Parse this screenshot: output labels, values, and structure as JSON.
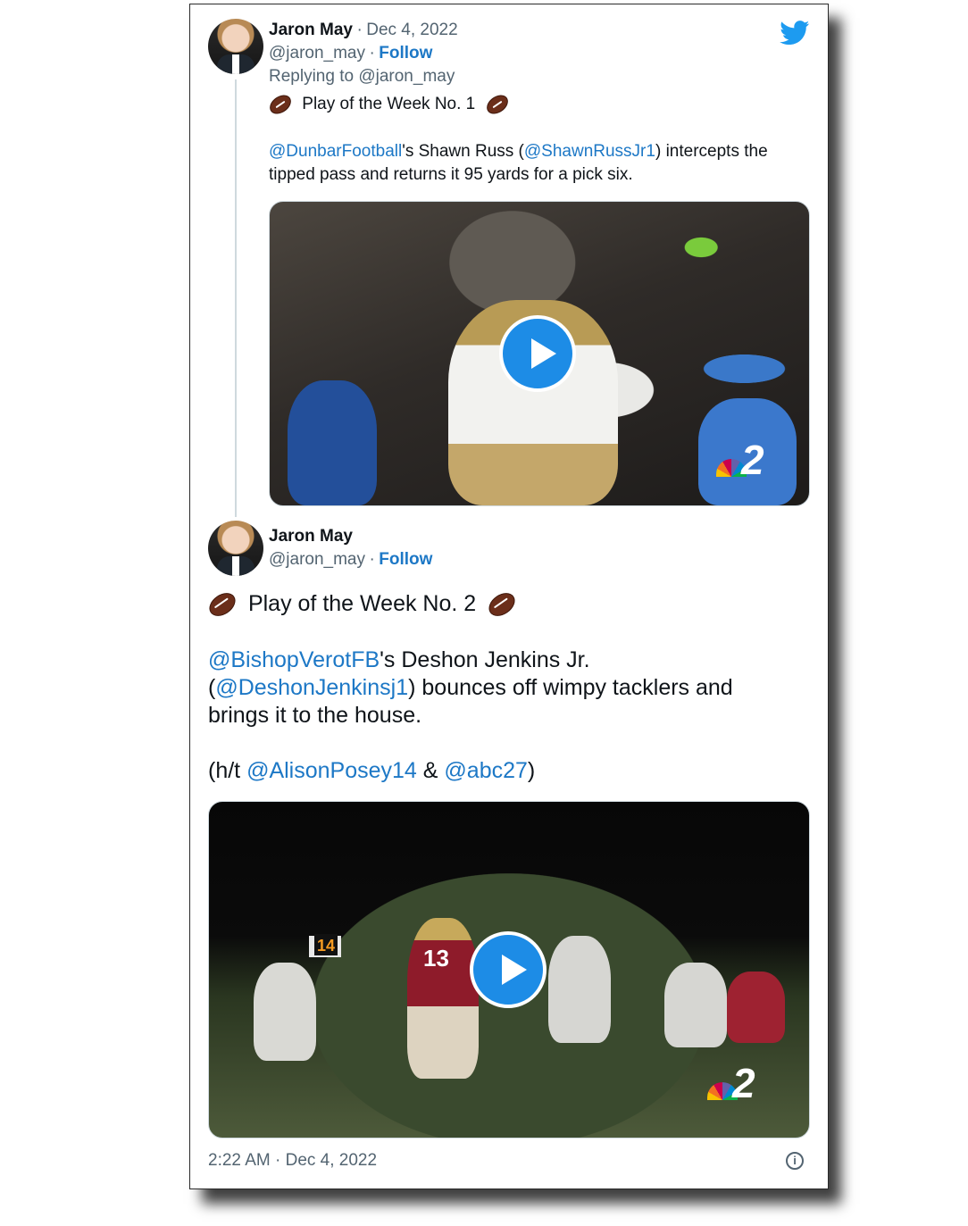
{
  "tweet1": {
    "author_name": "Jaron May",
    "date_sep": "·",
    "date": "Dec 4, 2022",
    "handle": "@jaron_may",
    "follow_sep": "·",
    "follow_label": "Follow",
    "replying_to": "Replying to @jaron_may",
    "title": "Play of the Week No. 1",
    "body": {
      "mention1": "@DunbarFootball",
      "text1": "'s Shawn Russ (",
      "mention2": "@ShawnRussJr1",
      "text2": ") intercepts the",
      "line2": "tipped pass and returns it 95 yards for a pick six."
    },
    "video_logo": "2"
  },
  "tweet2": {
    "author_name": "Jaron May",
    "handle": "@jaron_may",
    "follow_sep": "·",
    "follow_label": "Follow",
    "title": "Play of the Week No. 2",
    "body": {
      "mention1": "@BishopVerotFB",
      "text1": "'s Deshon Jenkins Jr.",
      "paren_open": "(",
      "mention2": "@DeshonJenkinsj1",
      "text2": ") bounces off wimpy tacklers and",
      "line3": "brings it to the house.",
      "ht_prefix": "(h/t ",
      "mention3": "@AlisonPosey14",
      "amp": " & ",
      "mention4": "@abc27",
      "ht_suffix": ")"
    },
    "video_logo": "2",
    "scoreboard": "14",
    "jersey": "13",
    "timestamp": "2:22 AM · Dec 4, 2022",
    "info_glyph": "i"
  },
  "colors": {
    "link": "#1d78c6",
    "muted": "#536471",
    "play_button": "#1d8ce6",
    "twitter_blue": "#1d9bf0"
  },
  "icons": {
    "brand": "twitter-bird-icon",
    "play": "play-icon",
    "football": "football-emoji-icon",
    "info": "info-icon"
  }
}
